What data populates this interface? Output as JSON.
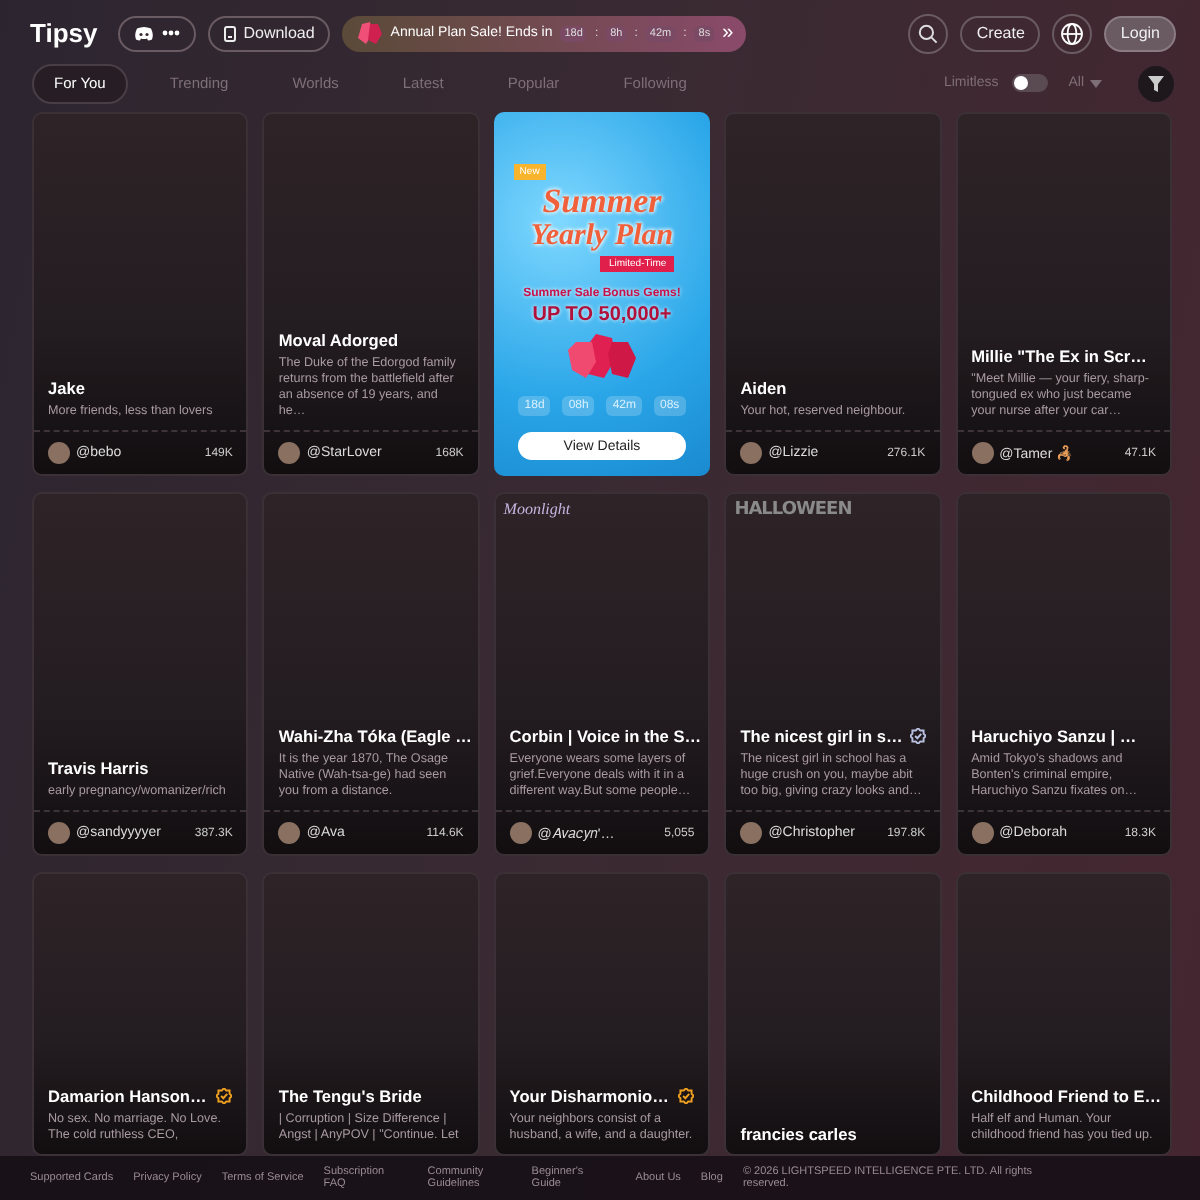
{
  "header": {
    "logo": "Tipsy",
    "download": "Download",
    "promo": {
      "text": "Annual Plan Sale! Ends in",
      "countdown": [
        "18d",
        "8h",
        "42m",
        "8s"
      ],
      "separator": ":",
      "more": "»"
    },
    "create": "Create",
    "login": "Login"
  },
  "tabs": [
    {
      "label": "For You",
      "selected": true
    },
    {
      "label": "Trending",
      "selected": false
    },
    {
      "label": "Worlds",
      "selected": false
    },
    {
      "label": "Latest",
      "selected": false
    },
    {
      "label": "Popular",
      "selected": false
    },
    {
      "label": "Following",
      "selected": false
    }
  ],
  "filters": {
    "limitless": {
      "label": "Limitless",
      "on": false
    },
    "sort": "All"
  },
  "cards": [
    {
      "kind": "character",
      "title": "Jake",
      "verified": false,
      "description": "More friends, less than lovers",
      "author": "@bebo",
      "count": "149K"
    },
    {
      "kind": "character",
      "title": "Moval Adorged",
      "verified": false,
      "description": "The Duke of the Edorgod family returns from the battlefield after an absence of 19 years, and he…",
      "author": "@StarLover",
      "count": "168K"
    },
    {
      "kind": "promo",
      "tag": "New",
      "headline": "Summer",
      "subheadline": "Yearly Plan",
      "ribbon": "Limited-Time",
      "bonus": "Summer Sale Bonus Gems!",
      "offer": "UP TO 50,000+",
      "countdown": [
        "18d",
        "08h",
        "42m",
        "08s"
      ],
      "button": "View Details"
    },
    {
      "kind": "character",
      "title": "Aiden",
      "verified": false,
      "description": "Your hot, reserved neighbour.",
      "author": "@Lizzie",
      "count": "276.1K"
    },
    {
      "kind": "character",
      "title": "Millie \"The Ex in Scr…",
      "verified": false,
      "description": "\"Meet Millie — your fiery, sharp-tongued ex who just became your nurse after your car…",
      "author": "@Tamer 🦂",
      "count": "47.1K"
    },
    {
      "kind": "character",
      "title": "Travis Harris",
      "verified": false,
      "description": "early pregnancy/womanizer/rich",
      "author": "@sandyyyyer",
      "count": "387.3K"
    },
    {
      "kind": "character",
      "title": "Wahi-Zha Tóka (Eagle …",
      "verified": false,
      "description": "It is the year 1870, The Osage Native (Wah-tsa-ge) had seen you from a distance.",
      "author": "@Ava",
      "count": "114.6K"
    },
    {
      "kind": "character",
      "title": "Corbin | Voice in the S…",
      "verified": false,
      "banner": {
        "kind": "script",
        "text": "Moonlight"
      },
      "description": "Everyone wears some layers of grief.Everyone deals with it in a different way.But some people…",
      "author": "@𝐴𝑣𝑎𝑐𝑦𝑛'…",
      "count": "5,055"
    },
    {
      "kind": "character",
      "title": "The nicest girl in s…",
      "verified": true,
      "color": "#b8c0e0",
      "banner": {
        "kind": "spooky",
        "text": "HALLOWEEN"
      },
      "description": "The nicest girl in school has a huge crush on you, maybe abit too big, giving crazy looks and…",
      "author": "@Christopher",
      "count": "197.8K"
    },
    {
      "kind": "character",
      "title": "Haruchiyo Sanzu | …",
      "verified": false,
      "description": "Amid Tokyo's shadows and Bonten's criminal empire, Haruchiyo Sanzu fixates on…",
      "author": "@Deborah",
      "count": "18.3K"
    },
    {
      "kind": "character",
      "title": "Damarion Hanson…",
      "verified": true,
      "color": "#f0a020",
      "description": "No sex. No marriage. No Love. The cold ruthless CEO,"
    },
    {
      "kind": "character",
      "title": "The Tengu's Bride",
      "verified": false,
      "description": "| Corruption | Size Difference | Angst | AnyPOV | \"Continue. Let"
    },
    {
      "kind": "character",
      "title": "Your Disharmonio…",
      "verified": true,
      "color": "#f0a020",
      "description": "Your neighbors consist of a husband, a wife, and a daughter."
    },
    {
      "kind": "character",
      "title": "francies carles",
      "verified": false
    },
    {
      "kind": "character",
      "title": "Childhood Friend to E…",
      "verified": false,
      "description": "Half elf and Human. Your childhood friend has you tied up."
    }
  ],
  "footer": {
    "links": [
      "Supported Cards",
      "Privacy Policy",
      "Terms of Service",
      "Subscription FAQ",
      "Community Guidelines",
      "Beginner's Guide",
      "About Us",
      "Blog"
    ],
    "copyright": "© 2026 LIGHTSPEED INTELLIGENCE PTE. LTD. All rights reserved."
  }
}
